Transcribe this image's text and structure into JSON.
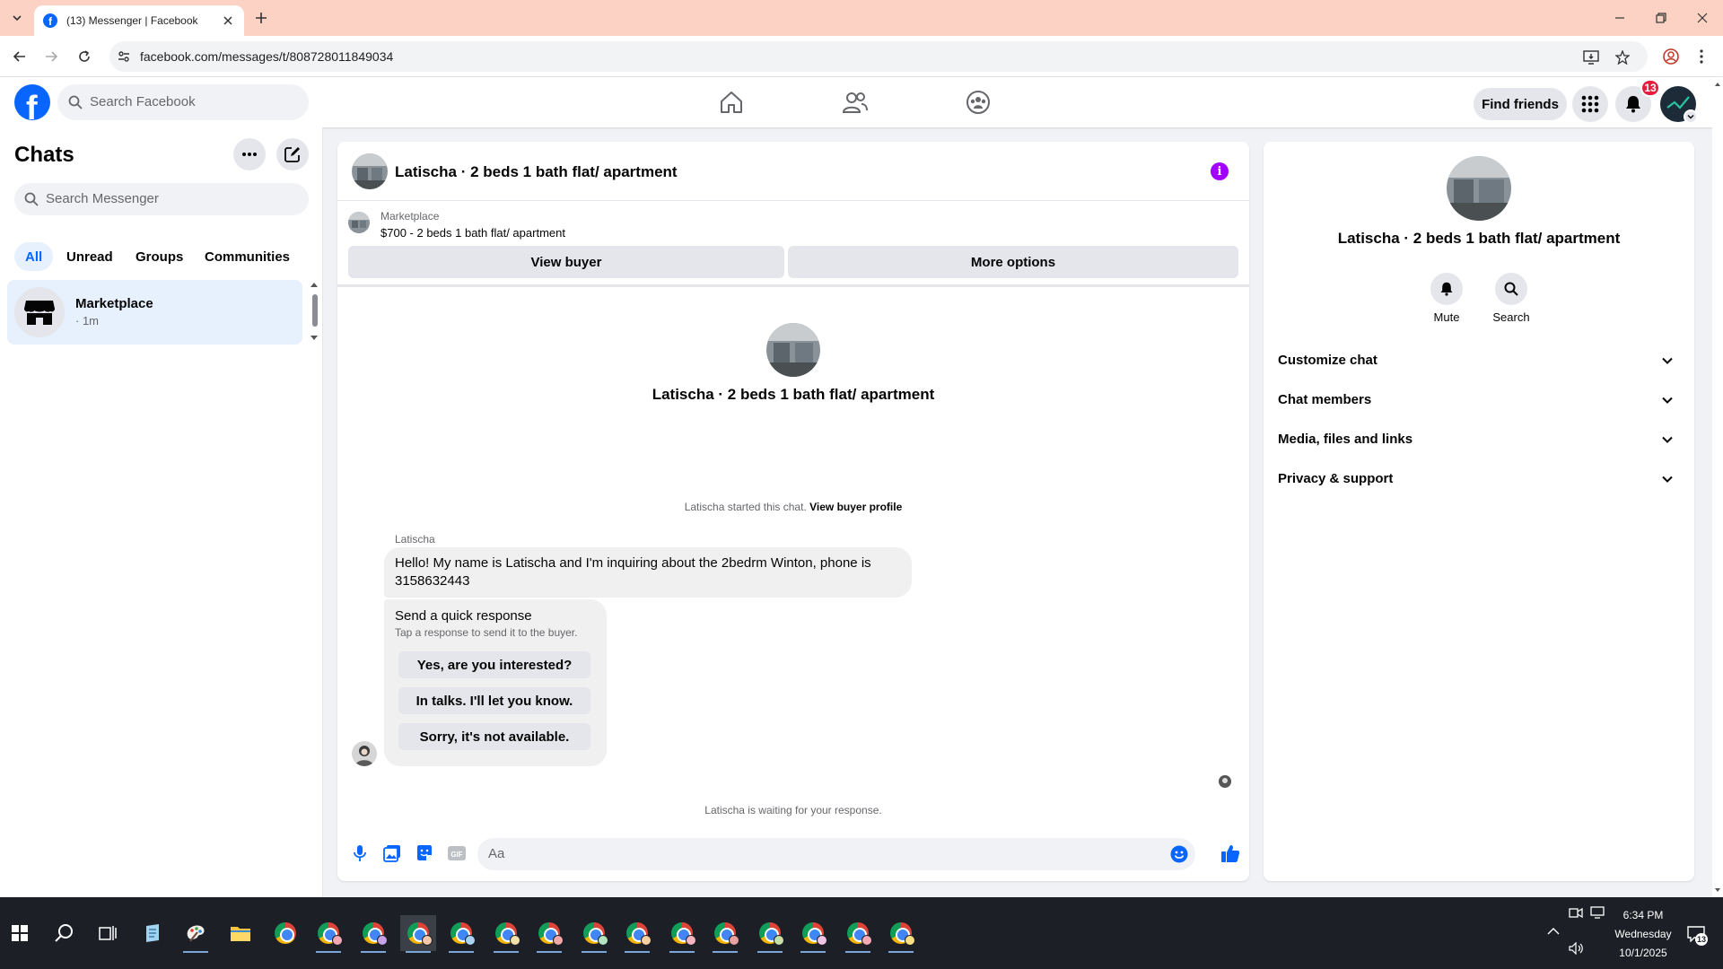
{
  "browser": {
    "tab_title": "(13) Messenger | Facebook",
    "url": "facebook.com/messages/t/808728011849034"
  },
  "fb_nav": {
    "search_placeholder": "Search Facebook",
    "find_friends": "Find friends",
    "notification_count": "13"
  },
  "sidebar": {
    "title": "Chats",
    "search_placeholder": "Search Messenger",
    "filters": [
      "All",
      "Unread",
      "Groups",
      "Communities"
    ],
    "active_filter": "All",
    "chats": [
      {
        "name": "Marketplace",
        "time": "· 1m"
      }
    ]
  },
  "conversation": {
    "title": "Latischa · 2 beds 1 bath flat/ apartment",
    "marketplace_label": "Marketplace",
    "listing": "$700 - 2 beds 1 bath flat/ apartment",
    "view_buyer": "View buyer",
    "more_options": "More options",
    "center_name": "Latischa · 2 beds 1 bath flat/ apartment",
    "started_text": "Latischa started this chat.",
    "view_buyer_profile": "View buyer profile",
    "sender": "Latischa",
    "message": "Hello! My name is Latischa and I'm inquiring about the 2bedrm Winton, phone is 3158632443",
    "quick_response": {
      "heading": "Send a quick response",
      "subtext": "Tap a response to send it to the buyer.",
      "options": [
        "Yes, are you interested?",
        "In talks. I'll let you know.",
        "Sorry, it's not available."
      ]
    },
    "waiting": "Latischa is waiting for your response.",
    "composer_placeholder": "Aa"
  },
  "details_panel": {
    "name": "Latischa · 2 beds 1 bath flat/ apartment",
    "actions": [
      "Mute",
      "Search"
    ],
    "sections": [
      "Customize chat",
      "Chat members",
      "Media, files and links",
      "Privacy & support"
    ]
  },
  "taskbar": {
    "time": "6:34 PM",
    "day": "Wednesday",
    "date": "10/1/2025",
    "notification_count": "13"
  },
  "colors": {
    "brand_blue": "#0866ff",
    "tabstrip": "#fbd2c4",
    "info_purple": "#a200ff",
    "selected_bg": "#e7f0fd"
  }
}
